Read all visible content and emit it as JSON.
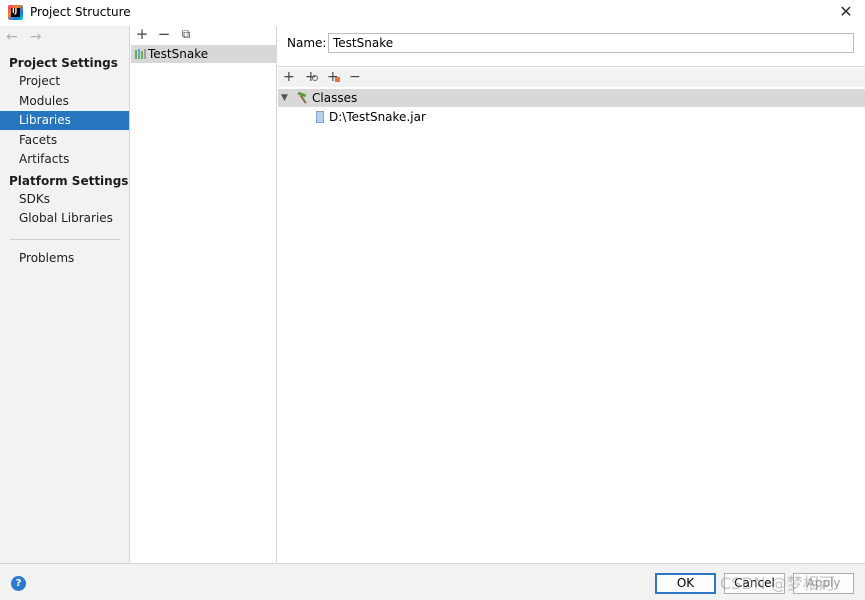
{
  "window": {
    "title": "Project Structure",
    "close_glyph": "✕"
  },
  "nav_arrows": {
    "back": "←",
    "forward": "→"
  },
  "sidebar": {
    "project_settings_title": "Project Settings",
    "platform_settings_title": "Platform Settings",
    "items": [
      {
        "label": "Project"
      },
      {
        "label": "Modules"
      },
      {
        "label": "Libraries",
        "selected": true
      },
      {
        "label": "Facets"
      },
      {
        "label": "Artifacts"
      },
      {
        "label": "SDKs"
      },
      {
        "label": "Global Libraries"
      },
      {
        "label": "Problems"
      }
    ]
  },
  "library_list": {
    "toolbar": {
      "add": "+",
      "remove": "−",
      "copy": "⧉"
    },
    "items": [
      {
        "label": "TestSnake"
      }
    ]
  },
  "detail": {
    "name_label": "Name:",
    "name_value": "TestSnake",
    "toolbar": {
      "add": "+",
      "add_jar": "+",
      "add_special": "+",
      "remove": "−"
    },
    "tree": {
      "root_label": "Classes",
      "children": [
        {
          "label": "D:\\TestSnake.jar"
        }
      ]
    }
  },
  "footer": {
    "help": "?",
    "ok": "OK",
    "cancel": "Cancel",
    "apply": "Apply"
  },
  "watermark": "CSDN @梦相河",
  "colors": {
    "selection": "#2675bf",
    "ok_border": "#2f77c4",
    "panel_bg": "#f2f2f2"
  }
}
